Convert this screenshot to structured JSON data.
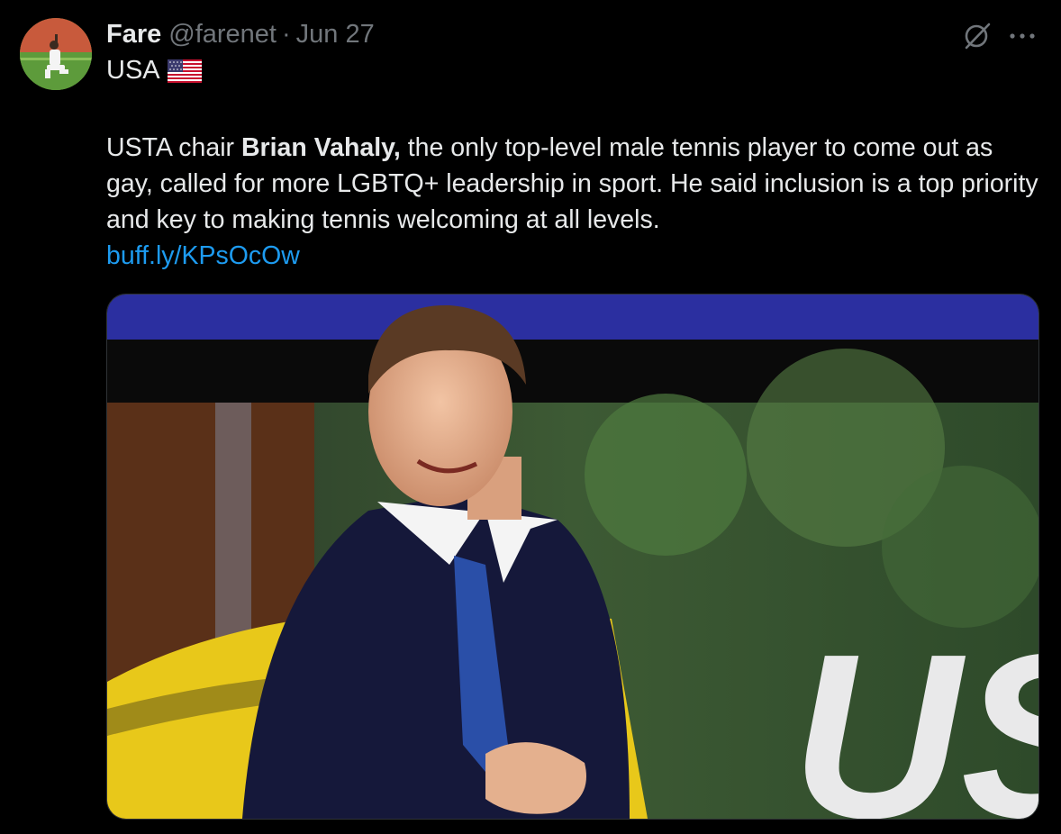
{
  "tweet": {
    "author_name": "Fare",
    "author_handle": "@farenet",
    "separator": "·",
    "date": "Jun 27",
    "location_text": "USA",
    "text_before": "USTA chair ",
    "text_bold": "Brian Vahaly,",
    "text_after": " the only top-level male tennis player to come out as gay, called for more LGBTQ+ leadership in sport. He said inclusion is a top priority and key to making tennis welcoming at all levels.",
    "link": "buff.ly/KPsOcOw",
    "media_logo_text": "US"
  },
  "icons": {
    "grok": "grok-icon",
    "more": "more-icon",
    "flag": "us-flag-icon"
  },
  "colors": {
    "background": "#000000",
    "text": "#e7e9ea",
    "muted": "#71767b",
    "link": "#1d9bf0"
  }
}
